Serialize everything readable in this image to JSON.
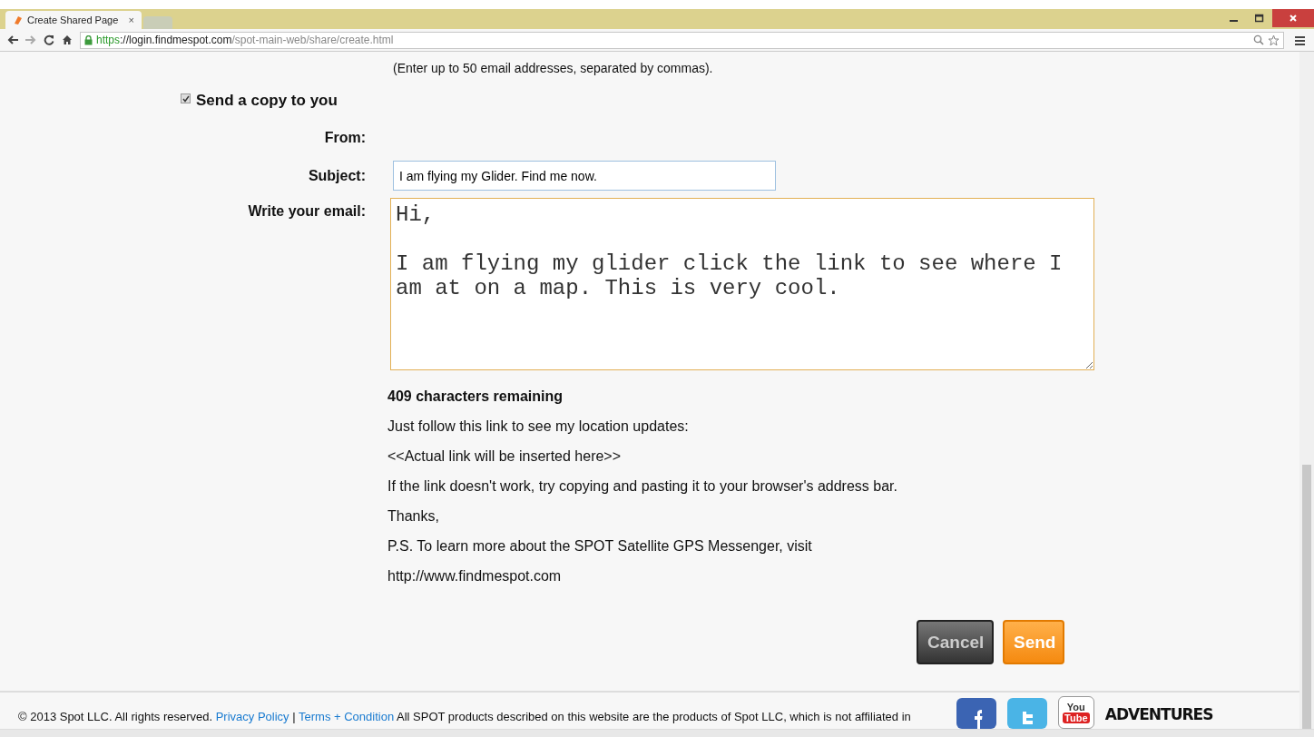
{
  "browser": {
    "tabs": [
      {
        "title": "Create Shared Page",
        "selected": true,
        "close": "×"
      },
      {
        "selected": false
      }
    ],
    "url": {
      "scheme": "https",
      "host": "://login.findmespot.com",
      "path": "/spot-main-web/share/create.html"
    }
  },
  "form": {
    "hint": "(Enter up to 50 email addresses, separated by commas).",
    "copy": {
      "label": "Send a copy to you",
      "checked": true
    },
    "from_label": "From:",
    "subject": {
      "label": "Subject:",
      "value": "I am flying my Glider. Find me now."
    },
    "email": {
      "label": "Write your email:",
      "value": "Hi,\n\nI am flying my glider click the link to see where I am at on a map. This is very cool."
    },
    "remaining": "409 characters remaining",
    "message_lines": [
      "Just follow this link to see my location updates:",
      "<<Actual link will be inserted here>>",
      "If the link doesn't work, try copying and pasting it to your browser's address bar.",
      "Thanks,",
      "P.S. To learn more about the SPOT Satellite GPS Messenger, visit",
      "http://www.findmespot.com"
    ],
    "buttons": [
      {
        "label": "Cancel",
        "kind": "secondary"
      },
      {
        "label": "Send",
        "kind": "primary"
      }
    ]
  },
  "footer": {
    "copyright": "© 2013 Spot LLC. All rights reserved.",
    "links": [
      "Privacy Policy",
      "Terms + Condition"
    ],
    "separator": "|",
    "notice": "All SPOT products described on this website are the products of Spot LLC, which is not affiliated in",
    "social": [
      {
        "kind": "facebook"
      },
      {
        "kind": "twitter"
      },
      {
        "kind": "youtube",
        "top": "You",
        "bottom": "Tube"
      },
      {
        "kind": "adventures",
        "label": "ADVENTURES"
      }
    ]
  }
}
